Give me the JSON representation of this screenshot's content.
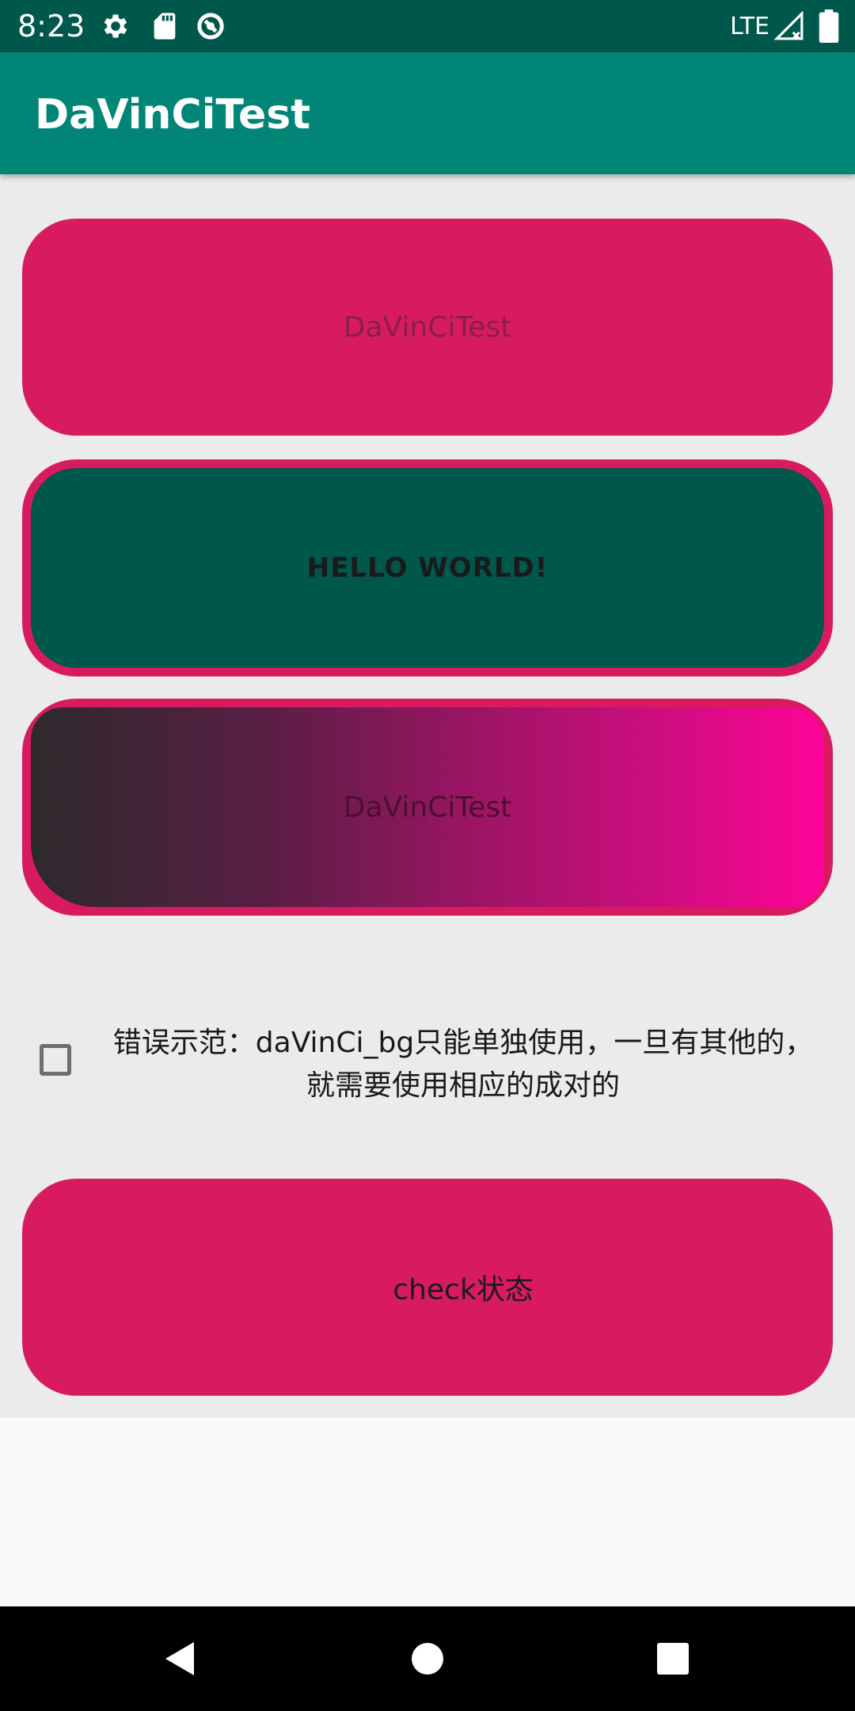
{
  "status_bar": {
    "time": "8:23",
    "network": "LTE",
    "icons": [
      "settings-icon",
      "sd-card-icon",
      "data-saver-icon",
      "signal-icon",
      "battery-icon"
    ]
  },
  "app_bar": {
    "title": "DaVinCiTest"
  },
  "cards": {
    "card1_label": "DaVinCiTest",
    "card2_label": "HELLO WORLD!",
    "card3_label": "DaVinCiTest",
    "check_button_label": "check状态"
  },
  "checkbox": {
    "checked": false,
    "text_line1": "错误示范：daVinCi_bg只能单独使用，一旦有其他的，",
    "text_line2": "就需要使用相应的成对的"
  },
  "colors": {
    "status_bar": "#00574b",
    "app_bar": "#008577",
    "accent": "#d81b60",
    "dark_teal": "#00574b",
    "gradient_start": "#2d2a2c",
    "gradient_end": "#ff0497"
  },
  "nav_bar": {
    "icons": [
      "back-icon",
      "home-icon",
      "recents-icon"
    ]
  }
}
